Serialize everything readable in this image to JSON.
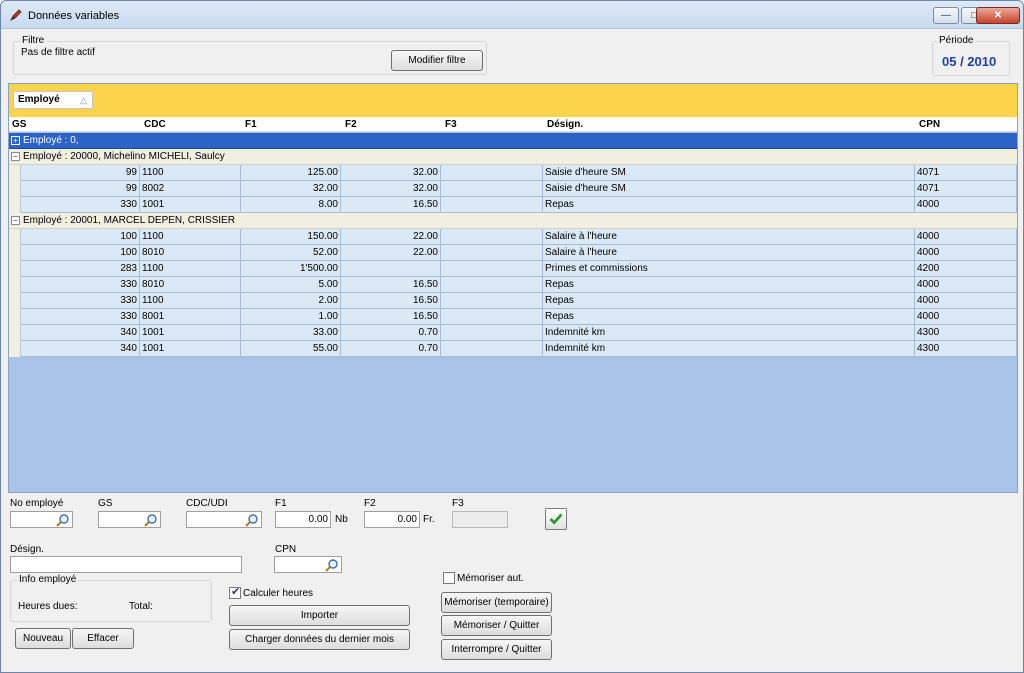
{
  "window": {
    "title": "Données variables"
  },
  "filter": {
    "group_label": "Filtre",
    "status": "Pas de filtre actif",
    "modify_button": "Modifier filtre"
  },
  "period": {
    "group_label": "Période",
    "value": "05 / 2010"
  },
  "grid": {
    "group_by": {
      "label": "Employé",
      "sort_glyph": "△"
    },
    "columns": [
      "GS",
      "CDC",
      "F1",
      "F2",
      "F3",
      "Désign.",
      "CPN"
    ],
    "groups": [
      {
        "label": "Employé : 0,",
        "expander": "+",
        "selected": true,
        "rows": []
      },
      {
        "label": "Employé : 20000, Michelino MICHELI, Saulcy",
        "expander": "−",
        "selected": false,
        "rows": [
          {
            "gs": "99",
            "cdc": "1100",
            "f1": "125.00",
            "f2": "32.00",
            "f3": "",
            "design": "Saisie d'heure SM",
            "cpn": "4071"
          },
          {
            "gs": "99",
            "cdc": "8002",
            "f1": "32.00",
            "f2": "32.00",
            "f3": "",
            "design": "Saisie d'heure SM",
            "cpn": "4071"
          },
          {
            "gs": "330",
            "cdc": "1001",
            "f1": "8.00",
            "f2": "16.50",
            "f3": "",
            "design": "Repas",
            "cpn": "4000"
          }
        ]
      },
      {
        "label": "Employé : 20001, MARCEL DEPEN, CRISSIER",
        "expander": "−",
        "selected": false,
        "rows": [
          {
            "gs": "100",
            "cdc": "1100",
            "f1": "150.00",
            "f2": "22.00",
            "f3": "",
            "design": "Salaire à l'heure",
            "cpn": "4000"
          },
          {
            "gs": "100",
            "cdc": "8010",
            "f1": "52.00",
            "f2": "22.00",
            "f3": "",
            "design": "Salaire à l'heure",
            "cpn": "4000"
          },
          {
            "gs": "283",
            "cdc": "1100",
            "f1": "1'500.00",
            "f2": "",
            "f3": "",
            "design": "Primes et commissions",
            "cpn": "4200"
          },
          {
            "gs": "330",
            "cdc": "8010",
            "f1": "5.00",
            "f2": "16.50",
            "f3": "",
            "design": "Repas",
            "cpn": "4000"
          },
          {
            "gs": "330",
            "cdc": "1100",
            "f1": "2.00",
            "f2": "16.50",
            "f3": "",
            "design": "Repas",
            "cpn": "4000"
          },
          {
            "gs": "330",
            "cdc": "8001",
            "f1": "1.00",
            "f2": "16.50",
            "f3": "",
            "design": "Repas",
            "cpn": "4000"
          },
          {
            "gs": "340",
            "cdc": "1001",
            "f1": "33.00",
            "f2": "0.70",
            "f3": "",
            "design": "Indemnité km",
            "cpn": "4300"
          },
          {
            "gs": "340",
            "cdc": "1001",
            "f1": "55.00",
            "f2": "0.70",
            "f3": "",
            "design": "Indemnité km",
            "cpn": "4300"
          }
        ]
      }
    ]
  },
  "form": {
    "no_employe_label": "No employé",
    "gs_label": "GS",
    "cdc_label": "CDC/UDI",
    "f1_label": "F1",
    "f1_value": "0.00",
    "f1_unit": "Nb",
    "f2_label": "F2",
    "f2_value": "0.00",
    "f2_unit": "Fr.",
    "f3_label": "F3",
    "design_label": "Désign.",
    "cpn_label": "CPN",
    "info_label": "Info employé",
    "heures_dues_label": "Heures dues:",
    "total_label": "Total:",
    "calc_label": "Calculer heures",
    "calc_checked": true,
    "memoriser_aut_label": "Mémoriser aut.",
    "memoriser_aut_checked": false
  },
  "buttons": {
    "nouveau": "Nouveau",
    "effacer": "Effacer",
    "importer": "Importer",
    "charger": "Charger données du dernier mois",
    "memoriser_temp": "Mémoriser (temporaire)",
    "memoriser_quitter": "Mémoriser / Quitter",
    "interrompre": "Interrompre / Quitter"
  },
  "colors": {
    "group_bar": "#fbd44c",
    "grid_bg": "#a8c4e8",
    "selected_row": "#2b63c6",
    "period_text": "#1f3faa",
    "check_green": "#2e9a2e"
  },
  "icons": {
    "app": "pen-icon",
    "lookup": "magnifier-icon",
    "validate": "checkmark-icon"
  }
}
